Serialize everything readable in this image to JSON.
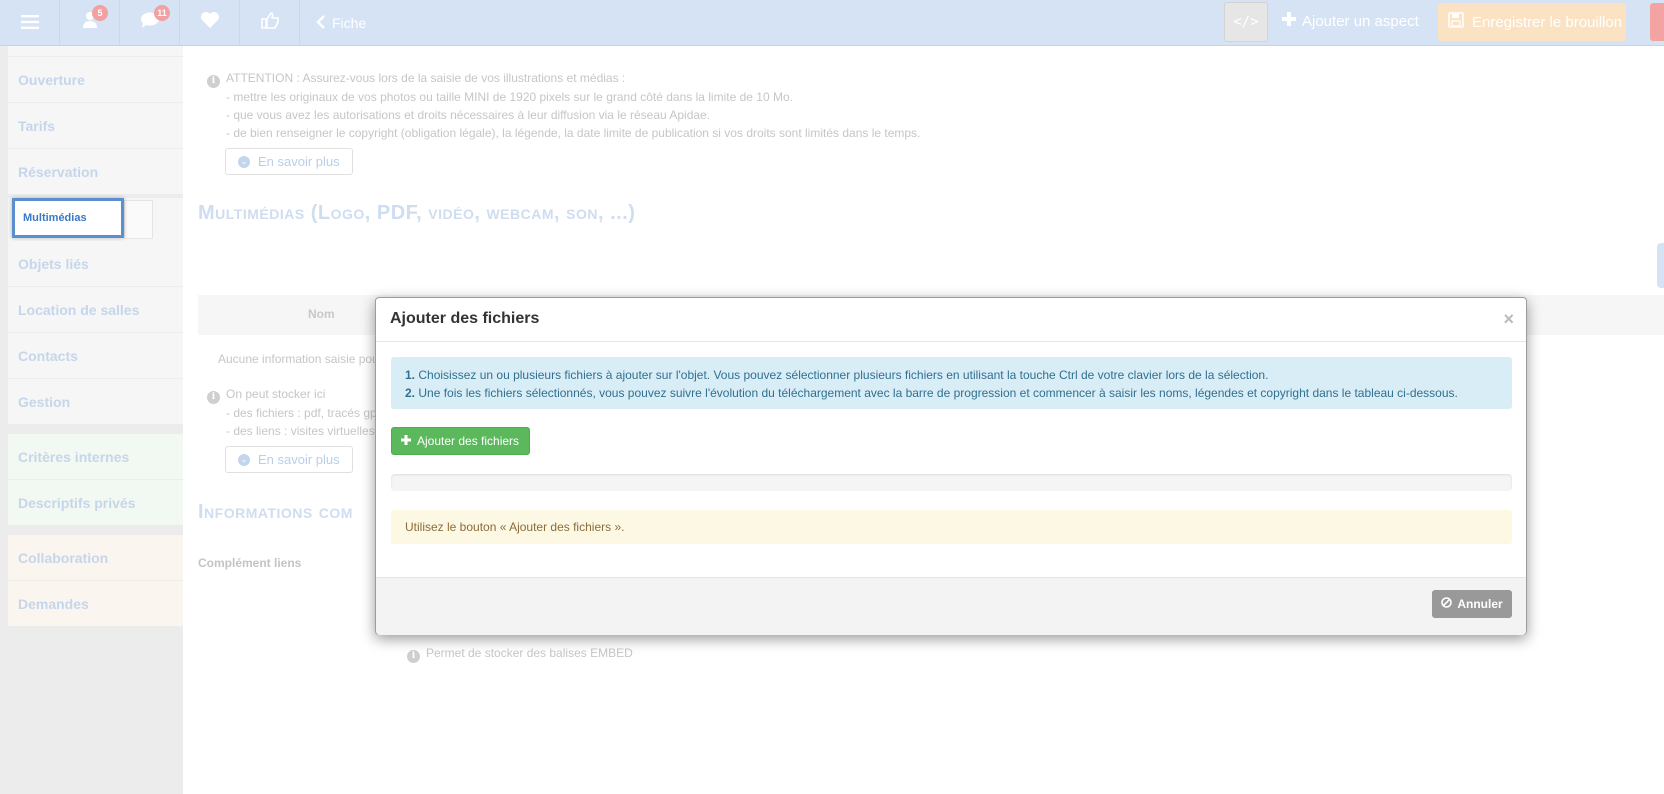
{
  "topbar": {
    "menu_icon": "hamburger-icon",
    "notifications_count": "5",
    "messages_count": "11",
    "back_label": "Fiche",
    "code_label": "</>",
    "add_aspect_label": "Ajouter un aspect",
    "save_draft_label": "Enregistrer le brouillon"
  },
  "sidebar": {
    "items": [
      {
        "label": "Ouverture"
      },
      {
        "label": "Tarifs"
      },
      {
        "label": "Réservation"
      },
      {
        "label": "Multimédias"
      },
      {
        "label": "Objets liés"
      },
      {
        "label": "Location de salles"
      },
      {
        "label": "Contacts"
      },
      {
        "label": "Gestion"
      },
      {
        "label": "Critères internes"
      },
      {
        "label": "Descriptifs privés"
      },
      {
        "label": "Collaboration"
      },
      {
        "label": "Demandes"
      }
    ]
  },
  "main": {
    "attention": {
      "line1": "ATTENTION : Assurez-vous lors de la saisie de vos illustrations et médias :",
      "line2": "- mettre les originaux de vos photos ou taille MINI de 1920 pixels sur le grand côté dans la limite de 10 Mo.",
      "line3": "- que vous avez les autorisations et droits nécessaires à leur diffusion via le réseau Apidae.",
      "line4": "- de bien renseigner le copyright (obligation légale), la légende, la date limite de publication si vos droits sont limités dans le temps."
    },
    "savoir_plus_label": "En savoir plus",
    "multimedia_title": "Multimédias (Logo, PDF, vidéo, webcam, son, ...)",
    "table_col_nom": "Nom",
    "no_info": "Aucune information saisie pou",
    "storage_info": {
      "line1": "On peut stocker ici",
      "line2": "- des fichiers : pdf, tracés gp",
      "line3": "- des liens : visites virtuelles"
    },
    "info_section_title": "Informations com",
    "complement_liens": "Complément liens",
    "embed_note": "Permet de stocker des balises EMBED"
  },
  "modal": {
    "title": "Ajouter des fichiers",
    "close_label": "×",
    "step1_num": "1.",
    "step1_text": "Choisissez un ou plusieurs fichiers à ajouter sur l'objet. Vous pouvez sélectionner plusieurs fichiers en utilisant la touche Ctrl de votre clavier lors de la sélection.",
    "step2_num": "2.",
    "step2_text": "Une fois les fichiers sélectionnés, vous pouvez suivre l'évolution du téléchargement avec la barre de progression et commencer à saisir les noms, légendes et copyright dans le tableau ci-dessous.",
    "add_files_label": "Ajouter des fichiers",
    "warning": "Utilisez le bouton « Ajouter des fichiers ».",
    "cancel_label": "Annuler",
    "progress": 0
  },
  "colors": {
    "topbar": "#d5e3f5",
    "active_nav": "#5b8fd0",
    "success": "#5cb85c",
    "info_bg": "#d9edf7",
    "warning_bg": "#fcf8e3"
  }
}
